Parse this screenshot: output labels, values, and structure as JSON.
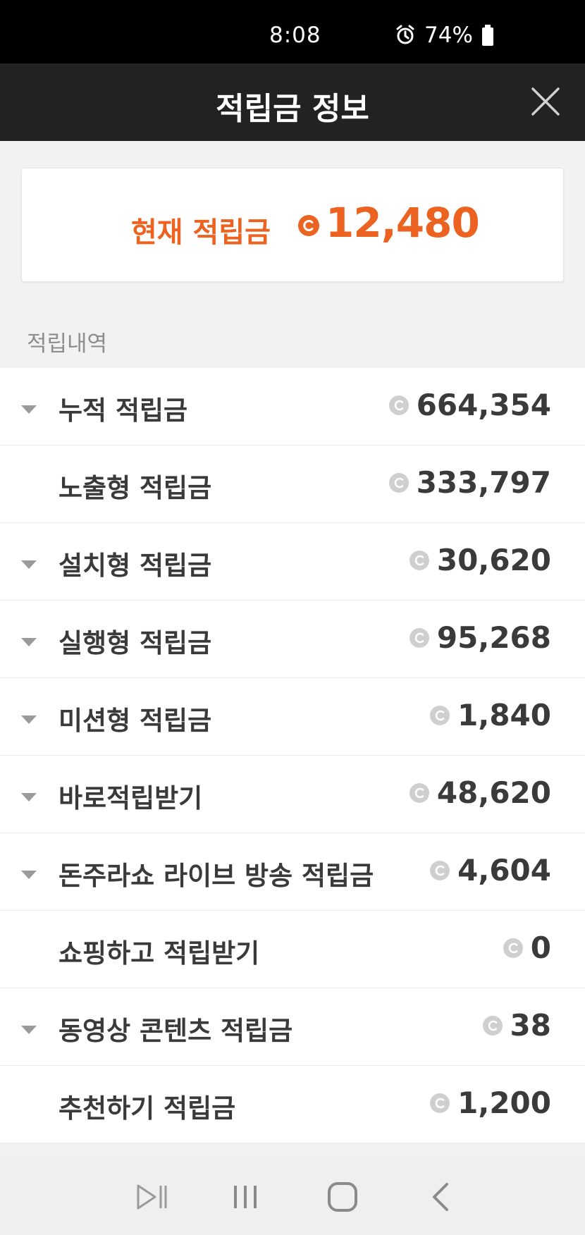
{
  "status": {
    "time": "8:08",
    "battery": "74%"
  },
  "header": {
    "title": "적립금 정보"
  },
  "balance": {
    "label": "현재 적립금",
    "value": "12,480"
  },
  "section_label": "적립내역",
  "rows": [
    {
      "label": "누적 적립금",
      "amount": "664,354",
      "expandable": true
    },
    {
      "label": "노출형 적립금",
      "amount": "333,797",
      "expandable": false
    },
    {
      "label": "설치형 적립금",
      "amount": "30,620",
      "expandable": true
    },
    {
      "label": "실행형 적립금",
      "amount": "95,268",
      "expandable": true
    },
    {
      "label": "미션형 적립금",
      "amount": "1,840",
      "expandable": true
    },
    {
      "label": "바로적립받기",
      "amount": "48,620",
      "expandable": true
    },
    {
      "label": "돈주라쇼 라이브 방송 적립금",
      "amount": "4,604",
      "expandable": true
    },
    {
      "label": "쇼핑하고 적립받기",
      "amount": "0",
      "expandable": false
    },
    {
      "label": "동영상 콘텐츠 적립금",
      "amount": "38",
      "expandable": true
    },
    {
      "label": "추천하기 적립금",
      "amount": "1,200",
      "expandable": false
    }
  ],
  "colors": {
    "accent": "#ec6220",
    "header_bg": "#222222",
    "text": "#3a3a3a",
    "coin_gray": "#cfcfcf"
  },
  "icons": {
    "coin": "coin-c-icon",
    "caret": "caret-down-icon",
    "close": "close-icon"
  }
}
